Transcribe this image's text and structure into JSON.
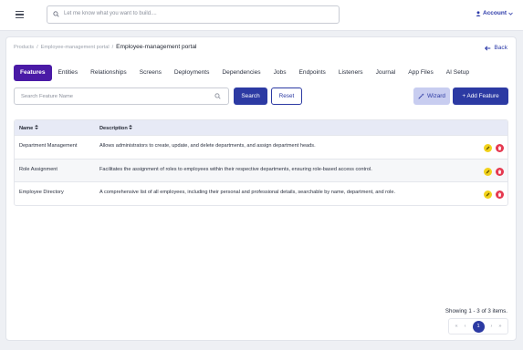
{
  "topbar": {
    "search_placeholder": "Let me know what you want to build....",
    "account_label": "Account"
  },
  "breadcrumb": {
    "items": [
      "Products",
      "Employee-management portal"
    ],
    "separator": "/",
    "current": "Employee-management portal"
  },
  "back_label": "Back",
  "tabs": [
    "Features",
    "Entities",
    "Relationships",
    "Screens",
    "Deployments",
    "Dependencies",
    "Jobs",
    "Endpoints",
    "Listeners",
    "Journal",
    "App Files",
    "AI Setup"
  ],
  "active_tab": "Features",
  "toolbar": {
    "search_placeholder": "Search Feature Name",
    "search_label": "Search",
    "reset_label": "Reset",
    "wizard_label": "Wizard",
    "add_label": "+ Add Feature"
  },
  "table": {
    "columns": [
      "Name",
      "Description"
    ],
    "sort_icon": "sort-icon",
    "rows": [
      {
        "name": "Department Management",
        "description": "Allows administrators to create, update, and delete departments, and assign department heads."
      },
      {
        "name": "Role Assignment",
        "description": "Facilitates the assignment of roles to employees within their respective departments, ensuring role-based access control."
      },
      {
        "name": "Employee Directory",
        "description": "A comprehensive list of all employees, including their personal and professional details, searchable by name, department, and role."
      }
    ]
  },
  "pagination": {
    "summary": "Showing 1 - 3 of 3 items.",
    "current_page": "1",
    "first": "«",
    "prev": "‹",
    "next": "›",
    "last": "»"
  },
  "colors": {
    "primary": "#2c3aa3",
    "active_tab": "#4a1aa6",
    "edit": "#f2d21b",
    "delete": "#e5384f"
  }
}
